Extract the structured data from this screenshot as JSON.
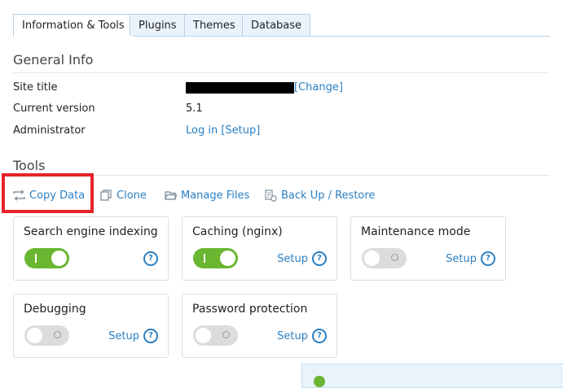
{
  "tabs": [
    {
      "label": "Information & Tools",
      "active": true
    },
    {
      "label": "Plugins",
      "active": false
    },
    {
      "label": "Themes",
      "active": false
    },
    {
      "label": "Database",
      "active": false
    }
  ],
  "general_info": {
    "title": "General Info",
    "site_title_label": "Site title",
    "change_link": "[Change]",
    "current_version_label": "Current version",
    "current_version_value": "5.1",
    "administrator_label": "Administrator",
    "login_link": "Log in",
    "setup_link": "[Setup]"
  },
  "tools": {
    "title": "Tools",
    "items": [
      {
        "label": "Copy Data",
        "icon": "copy-data-icon"
      },
      {
        "label": "Clone",
        "icon": "clone-icon"
      },
      {
        "label": "Manage Files",
        "icon": "folder-icon"
      },
      {
        "label": "Back Up / Restore",
        "icon": "backup-icon"
      }
    ]
  },
  "cards": [
    {
      "title": "Search engine indexing",
      "toggle": "on",
      "setup": ""
    },
    {
      "title": "Caching (nginx)",
      "toggle": "on",
      "setup": "Setup"
    },
    {
      "title": "Maintenance mode",
      "toggle": "off",
      "setup": "Setup"
    },
    {
      "title": "Debugging",
      "toggle": "off",
      "setup": "Setup"
    },
    {
      "title": "Password protection",
      "toggle": "off",
      "setup": "Setup"
    }
  ],
  "colors": {
    "link": "#2a7fc2",
    "toggle_on": "#6ab630",
    "highlight": "#e8222a"
  }
}
